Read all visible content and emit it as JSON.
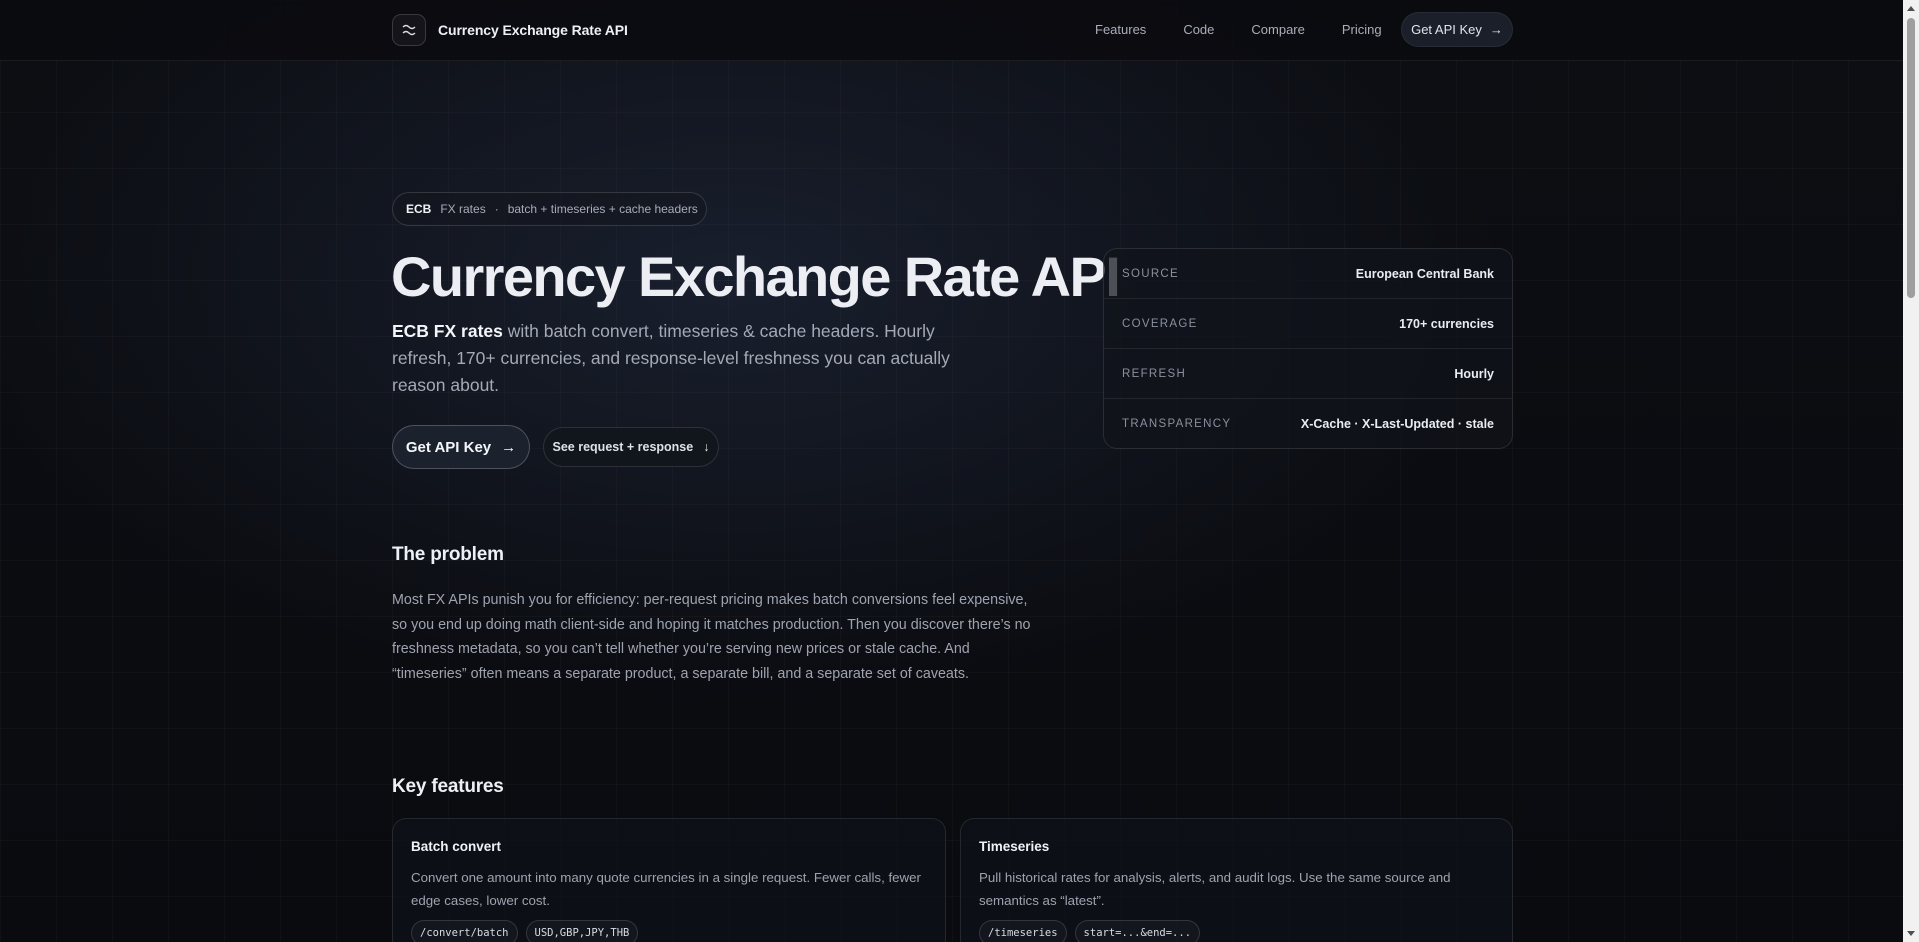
{
  "nav": {
    "brand_title": "Currency Exchange Rate API",
    "brand_icon": "wave-lines-icon",
    "links": [
      "Features",
      "Code",
      "Compare",
      "Pricing"
    ],
    "cta_label": "Get API Key",
    "cta_arrow": "→"
  },
  "hero": {
    "pill": {
      "badge": "ECB",
      "label": "FX rates",
      "separator": "·",
      "detail": "batch + timeseries + cache headers"
    },
    "title": "Currency Exchange Rate API",
    "subtitle_strong": "ECB FX rates",
    "subtitle_rest": " with batch convert, timeseries & cache headers. Hourly refresh, 170+ currencies, and response-level freshness you can actually reason about.",
    "primary_button": "Get API Key",
    "primary_arrow": "→",
    "secondary_button": "See request + response",
    "secondary_arrow": "↓"
  },
  "stats": [
    {
      "key": "SOURCE",
      "value": "European Central Bank"
    },
    {
      "key": "COVERAGE",
      "value": "170+ currencies"
    },
    {
      "key": "REFRESH",
      "value": "Hourly"
    },
    {
      "key": "TRANSPARENCY",
      "value": "X-Cache · X-Last-Updated · stale"
    }
  ],
  "problem": {
    "heading": "The problem",
    "text": "Most FX APIs punish you for efficiency: per-request pricing makes batch conversions feel expensive, so you end up doing math client-side and hoping it matches production. Then you discover there’s no freshness metadata, so you can’t tell whether you’re serving new prices or stale cache. And “timeseries” often means a separate product, a separate bill, and a separate set of caveats."
  },
  "features": {
    "heading": "Key features",
    "cards": [
      {
        "title": "Batch convert",
        "desc": "Convert one amount into many quote currencies in a single request. Fewer calls, fewer edge cases, lower cost.",
        "chips": [
          "/convert/batch",
          "USD,GBP,JPY,THB"
        ]
      },
      {
        "title": "Timeseries",
        "desc": "Pull historical rates for analysis, alerts, and audit logs. Use the same source and semantics as “latest”.",
        "chips": [
          "/timeseries",
          "start=...&end=..."
        ]
      }
    ]
  },
  "colors": {
    "background": "#0a0b0f",
    "surface": "#10131a",
    "text": "#eceef3",
    "muted": "#a4a9b6"
  }
}
